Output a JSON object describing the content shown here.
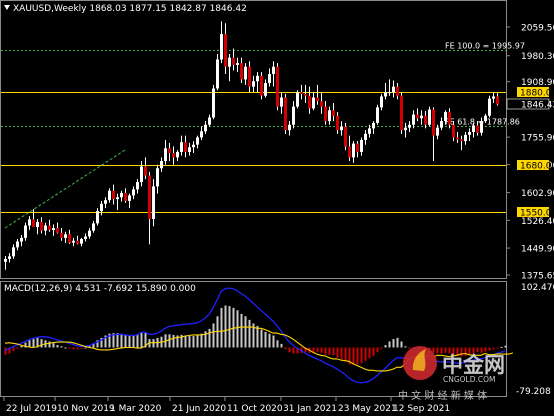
{
  "window": {
    "header": "XAUUSD,Weekly  1868.03 1877.15 1842.87 1846.42"
  },
  "colors": {
    "background": "#000000",
    "bull_body": "#ffffff",
    "bear_body": "#d40000",
    "level_line": "#ffd700",
    "fib_line": "#3cb44b",
    "trend_line": "#3cb44b",
    "macd_line": "#2020ff",
    "signal_line": "#ffd700",
    "hist_pos": "#c8c8c8",
    "hist_neg": "#d40000"
  },
  "price_axis": {
    "ticks": [
      "2059.56",
      "1980.30",
      "1908.90",
      "1755.90",
      "1680.00",
      "1602.90",
      "1526.40",
      "1449.90",
      "1375.65"
    ]
  },
  "macd_axis": {
    "ticks": [
      "102.476",
      "-79.208"
    ]
  },
  "date_axis": {
    "ticks": [
      "22 Jul 2019",
      "10 Nov 2019",
      "1 Mar 2020",
      "21 Jun 2020",
      "11 Oct 2020",
      "31 Jan 2021",
      "23 May 2021",
      "12 Sep 2021"
    ]
  },
  "levels": [
    {
      "name": "level-1880",
      "label": "1880.00",
      "price": 1880.0
    },
    {
      "name": "level-1680",
      "label": "1680.00",
      "price": 1680.0
    },
    {
      "name": "level-1550",
      "label": "1550.00",
      "price": 1550.0
    }
  ],
  "current_price_label": "1846.42",
  "fibs": [
    {
      "name": "fib-100",
      "label": "FE 100.0 = 1995.97",
      "price": 1995.97
    },
    {
      "name": "fib-61",
      "label": "FE 61.8 = 1787.86",
      "price": 1787.86
    }
  ],
  "macd_header": "MACD(12,26,9) 4.531 -7.692 15.890 0.000",
  "watermark": {
    "brand": "中金网",
    "domain": "CNGOLD.COM",
    "slogan": "中 文 财 经 新 媒 体"
  },
  "chart_data": {
    "type": "candlestick",
    "symbol": "XAUUSD",
    "timeframe": "Weekly",
    "title": "XAUUSD,Weekly",
    "y_range": [
      1375.65,
      2059.56
    ],
    "macd_range": [
      -79.208,
      102.476
    ],
    "last_ohlc": {
      "open": 1868.03,
      "high": 1877.15,
      "low": 1842.87,
      "close": 1846.42
    },
    "ohlc": [
      [
        1412,
        1428,
        1390,
        1420
      ],
      [
        1420,
        1436,
        1410,
        1427
      ],
      [
        1427,
        1460,
        1420,
        1452
      ],
      [
        1452,
        1475,
        1444,
        1468
      ],
      [
        1468,
        1486,
        1455,
        1478
      ],
      [
        1478,
        1520,
        1470,
        1512
      ],
      [
        1512,
        1538,
        1500,
        1529
      ],
      [
        1529,
        1557,
        1515,
        1508
      ],
      [
        1508,
        1530,
        1488,
        1522
      ],
      [
        1522,
        1535,
        1490,
        1498
      ],
      [
        1498,
        1520,
        1485,
        1512
      ],
      [
        1512,
        1528,
        1495,
        1500
      ],
      [
        1500,
        1515,
        1484,
        1505
      ],
      [
        1505,
        1520,
        1490,
        1492
      ],
      [
        1492,
        1505,
        1470,
        1478
      ],
      [
        1478,
        1495,
        1464,
        1488
      ],
      [
        1488,
        1500,
        1462,
        1465
      ],
      [
        1465,
        1478,
        1455,
        1470
      ],
      [
        1470,
        1484,
        1460,
        1462
      ],
      [
        1462,
        1478,
        1455,
        1475
      ],
      [
        1475,
        1490,
        1468,
        1482
      ],
      [
        1482,
        1505,
        1476,
        1498
      ],
      [
        1498,
        1525,
        1492,
        1518
      ],
      [
        1518,
        1560,
        1512,
        1552
      ],
      [
        1552,
        1580,
        1540,
        1572
      ],
      [
        1572,
        1590,
        1560,
        1582
      ],
      [
        1582,
        1615,
        1575,
        1608
      ],
      [
        1608,
        1625,
        1570,
        1585
      ],
      [
        1585,
        1600,
        1555,
        1590
      ],
      [
        1590,
        1608,
        1578,
        1602
      ],
      [
        1602,
        1615,
        1575,
        1580
      ],
      [
        1580,
        1600,
        1560,
        1595
      ],
      [
        1595,
        1620,
        1585,
        1612
      ],
      [
        1612,
        1640,
        1600,
        1632
      ],
      [
        1632,
        1690,
        1620,
        1675
      ],
      [
        1675,
        1700,
        1640,
        1650
      ],
      [
        1650,
        1660,
        1460,
        1530
      ],
      [
        1530,
        1640,
        1510,
        1620
      ],
      [
        1620,
        1680,
        1600,
        1670
      ],
      [
        1670,
        1700,
        1660,
        1690
      ],
      [
        1690,
        1748,
        1680,
        1725
      ],
      [
        1725,
        1740,
        1690,
        1712
      ],
      [
        1712,
        1730,
        1680,
        1700
      ],
      [
        1700,
        1720,
        1690,
        1715
      ],
      [
        1715,
        1760,
        1705,
        1742
      ],
      [
        1742,
        1760,
        1700,
        1715
      ],
      [
        1715,
        1740,
        1705,
        1728
      ],
      [
        1728,
        1745,
        1712,
        1735
      ],
      [
        1735,
        1760,
        1725,
        1755
      ],
      [
        1755,
        1785,
        1748,
        1772
      ],
      [
        1772,
        1800,
        1765,
        1790
      ],
      [
        1790,
        1818,
        1785,
        1810
      ],
      [
        1810,
        1900,
        1805,
        1890
      ],
      [
        1890,
        1985,
        1885,
        1970
      ],
      [
        1970,
        2075,
        1960,
        2040
      ],
      [
        2040,
        2070,
        1930,
        1950
      ],
      [
        1950,
        1985,
        1910,
        1975
      ],
      [
        1975,
        2000,
        1940,
        1955
      ],
      [
        1955,
        1975,
        1935,
        1960
      ],
      [
        1960,
        1975,
        1905,
        1915
      ],
      [
        1915,
        1960,
        1900,
        1950
      ],
      [
        1950,
        1965,
        1880,
        1895
      ],
      [
        1895,
        1925,
        1880,
        1910
      ],
      [
        1910,
        1935,
        1880,
        1925
      ],
      [
        1925,
        1935,
        1860,
        1870
      ],
      [
        1870,
        1915,
        1865,
        1905
      ],
      [
        1905,
        1945,
        1895,
        1930
      ],
      [
        1930,
        1965,
        1895,
        1950
      ],
      [
        1950,
        1960,
        1830,
        1840
      ],
      [
        1840,
        1880,
        1820,
        1865
      ],
      [
        1865,
        1875,
        1765,
        1775
      ],
      [
        1775,
        1800,
        1760,
        1790
      ],
      [
        1790,
        1855,
        1780,
        1840
      ],
      [
        1840,
        1885,
        1835,
        1880
      ],
      [
        1880,
        1900,
        1860,
        1875
      ],
      [
        1875,
        1900,
        1850,
        1870
      ],
      [
        1870,
        1895,
        1820,
        1835
      ],
      [
        1835,
        1880,
        1830,
        1865
      ],
      [
        1865,
        1900,
        1845,
        1855
      ],
      [
        1855,
        1880,
        1820,
        1840
      ],
      [
        1840,
        1855,
        1790,
        1800
      ],
      [
        1800,
        1840,
        1790,
        1830
      ],
      [
        1830,
        1850,
        1800,
        1815
      ],
      [
        1815,
        1825,
        1765,
        1775
      ],
      [
        1775,
        1800,
        1760,
        1785
      ],
      [
        1785,
        1795,
        1720,
        1730
      ],
      [
        1730,
        1760,
        1690,
        1700
      ],
      [
        1700,
        1745,
        1685,
        1738
      ],
      [
        1738,
        1745,
        1700,
        1715
      ],
      [
        1715,
        1755,
        1705,
        1748
      ],
      [
        1748,
        1775,
        1735,
        1765
      ],
      [
        1765,
        1790,
        1755,
        1780
      ],
      [
        1780,
        1800,
        1765,
        1795
      ],
      [
        1795,
        1845,
        1790,
        1838
      ],
      [
        1838,
        1875,
        1830,
        1868
      ],
      [
        1868,
        1905,
        1860,
        1880
      ],
      [
        1880,
        1915,
        1870,
        1880
      ],
      [
        1880,
        1912,
        1865,
        1895
      ],
      [
        1895,
        1905,
        1860,
        1870
      ],
      [
        1870,
        1880,
        1765,
        1775
      ],
      [
        1775,
        1795,
        1755,
        1782
      ],
      [
        1782,
        1800,
        1770,
        1790
      ],
      [
        1790,
        1830,
        1780,
        1818
      ],
      [
        1818,
        1835,
        1800,
        1808
      ],
      [
        1808,
        1830,
        1790,
        1815
      ],
      [
        1815,
        1828,
        1780,
        1790
      ],
      [
        1790,
        1840,
        1785,
        1832
      ],
      [
        1832,
        1838,
        1690,
        1760
      ],
      [
        1760,
        1790,
        1750,
        1782
      ],
      [
        1782,
        1810,
        1775,
        1800
      ],
      [
        1800,
        1830,
        1790,
        1825
      ],
      [
        1825,
        1835,
        1780,
        1790
      ],
      [
        1790,
        1800,
        1745,
        1755
      ],
      [
        1755,
        1770,
        1740,
        1750
      ],
      [
        1750,
        1760,
        1720,
        1745
      ],
      [
        1745,
        1770,
        1735,
        1762
      ],
      [
        1762,
        1780,
        1745,
        1770
      ],
      [
        1770,
        1795,
        1755,
        1788
      ],
      [
        1788,
        1800,
        1760,
        1768
      ],
      [
        1768,
        1810,
        1760,
        1800
      ],
      [
        1800,
        1820,
        1795,
        1815
      ],
      [
        1815,
        1870,
        1810,
        1862
      ],
      [
        1862,
        1880,
        1850,
        1868
      ],
      [
        1868.03,
        1877.15,
        1842.87,
        1846.42
      ]
    ],
    "macd_hist": [
      -12,
      -10,
      -6,
      -2,
      3,
      8,
      12,
      15,
      16,
      14,
      12,
      10,
      7,
      4,
      2,
      0,
      -2,
      -3,
      -3,
      -2,
      0,
      3,
      7,
      12,
      16,
      20,
      23,
      24,
      24,
      23,
      21,
      20,
      20,
      22,
      26,
      24,
      14,
      14,
      16,
      18,
      22,
      22,
      21,
      20,
      21,
      20,
      19,
      19,
      20,
      23,
      27,
      31,
      40,
      52,
      66,
      70,
      69,
      66,
      62,
      56,
      52,
      46,
      40,
      36,
      30,
      26,
      23,
      20,
      12,
      6,
      -3,
      -8,
      -10,
      -10,
      -9,
      -8,
      -9,
      -8,
      -8,
      -9,
      -12,
      -12,
      -13,
      -17,
      -19,
      -23,
      -28,
      -28,
      -28,
      -26,
      -22,
      -18,
      -14,
      -8,
      -2,
      4,
      10,
      14,
      16,
      10,
      2,
      -2,
      -2,
      -3,
      -4,
      -6,
      -4,
      -8,
      -10,
      -10,
      -9,
      -10,
      -12,
      -14,
      -15,
      -14,
      -12,
      -10,
      -8,
      -9,
      -7,
      -5,
      -3,
      -1,
      1,
      3
    ],
    "macd_line": [
      -5,
      -2,
      1,
      4,
      7,
      10,
      13,
      15,
      17,
      18,
      18,
      17,
      15,
      13,
      11,
      9,
      7,
      5,
      3,
      2,
      2,
      3,
      6,
      9,
      12,
      16,
      19,
      21,
      22,
      22,
      21,
      20,
      20,
      21,
      25,
      26,
      22,
      22,
      24,
      27,
      32,
      35,
      36,
      37,
      38,
      39,
      39,
      40,
      41,
      44,
      49,
      55,
      66,
      79,
      93,
      98,
      99,
      98,
      95,
      90,
      86,
      80,
      74,
      68,
      62,
      56,
      50,
      44,
      36,
      28,
      18,
      10,
      4,
      -1,
      -5,
      -9,
      -13,
      -16,
      -19,
      -22,
      -26,
      -29,
      -32,
      -36,
      -40,
      -45,
      -51,
      -55,
      -58,
      -59,
      -58,
      -56,
      -52,
      -47,
      -41,
      -35,
      -28,
      -22,
      -17,
      -17,
      -18,
      -18,
      -18,
      -19,
      -19,
      -20,
      -19,
      -21,
      -23,
      -24,
      -24,
      -24,
      -25,
      -26,
      -26,
      -25,
      -23,
      -21,
      -19,
      -19,
      -17,
      -14,
      -12,
      -10,
      -8,
      -6
    ],
    "signal_line": [
      7,
      8,
      7,
      6,
      4,
      2,
      1,
      0,
      1,
      4,
      6,
      7,
      8,
      9,
      9,
      9,
      9,
      8,
      6,
      4,
      2,
      0,
      -1,
      -3,
      -4,
      -4,
      -4,
      -3,
      -2,
      -1,
      0,
      0,
      0,
      -1,
      -1,
      2,
      8,
      8,
      8,
      9,
      10,
      13,
      15,
      17,
      17,
      19,
      20,
      21,
      21,
      21,
      22,
      24,
      26,
      27,
      27,
      28,
      30,
      32,
      33,
      34,
      34,
      34,
      34,
      32,
      32,
      30,
      27,
      24,
      24,
      22,
      21,
      18,
      14,
      9,
      4,
      -1,
      -4,
      -8,
      -11,
      -13,
      -14,
      -17,
      -19,
      -19,
      -21,
      -22,
      -23,
      -27,
      -30,
      -33,
      -36,
      -38,
      -38,
      -39,
      -39,
      -39,
      -38,
      -36,
      -33,
      -33,
      -28,
      -20,
      -16,
      -16,
      -15,
      -15,
      -13,
      -16,
      -13,
      -13,
      -14,
      -15,
      -14,
      -13,
      -11,
      -10,
      -12,
      -13,
      -13,
      -13,
      -10,
      -12,
      -12,
      -11,
      -11,
      -11,
      -11,
      -9
    ]
  }
}
